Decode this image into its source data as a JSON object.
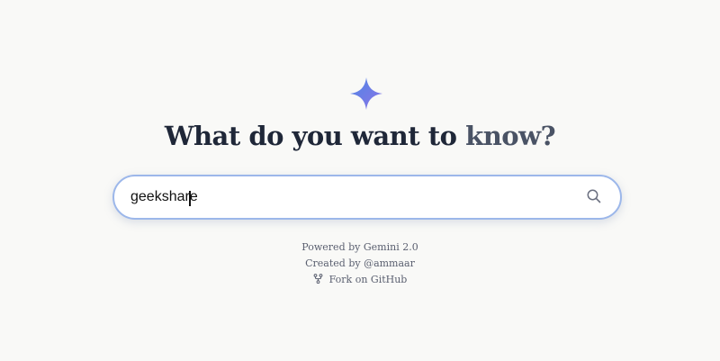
{
  "hero": {
    "title_part1": "What do you want to ",
    "title_part2": "know?"
  },
  "logo": {
    "icon": "sparkle-icon",
    "color_start": "#5b7be0",
    "color_end": "#8a78e8"
  },
  "search": {
    "value": "geekshare",
    "icon": "search-icon",
    "border_color": "#9cb7ea"
  },
  "footer": {
    "powered_by": "Powered by Gemini 2.0",
    "created_by": "Created by @ammaar",
    "fork_label": "Fork on GitHub",
    "fork_icon": "git-fork-icon"
  }
}
